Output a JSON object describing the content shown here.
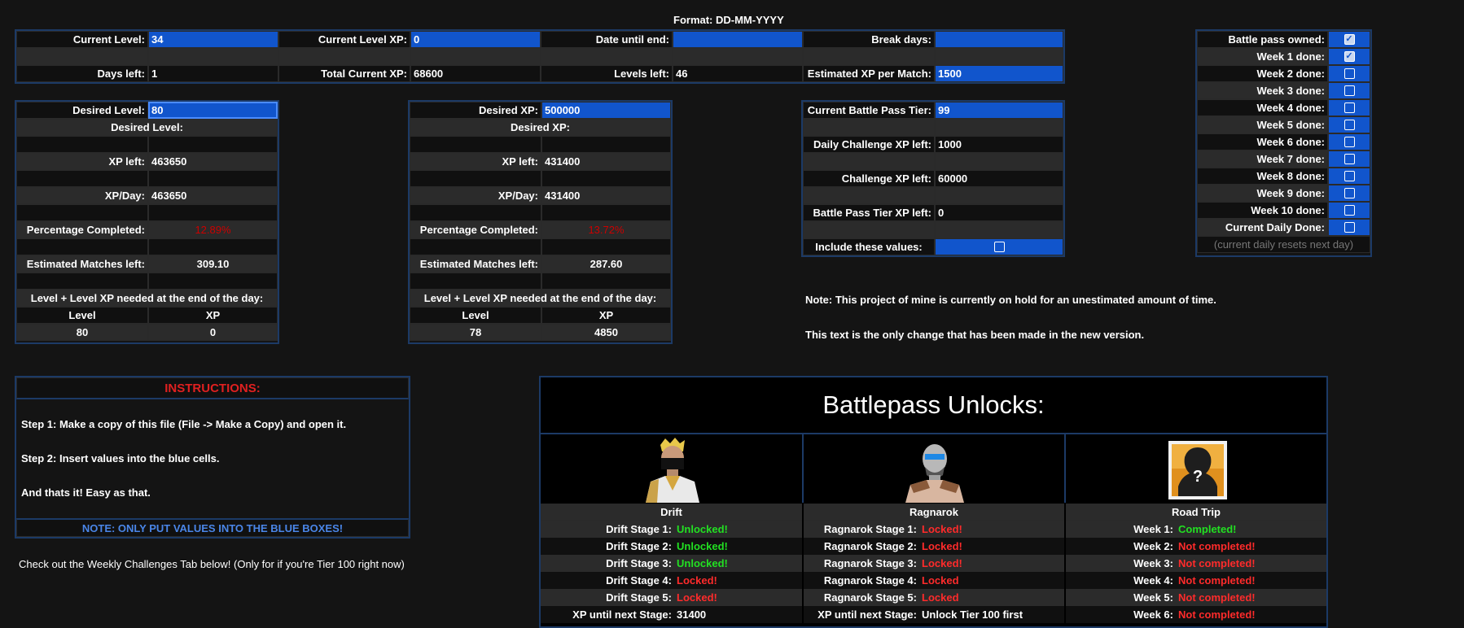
{
  "format_note": "Format: DD-MM-YYYY",
  "top": {
    "current_level_label": "Current Level:",
    "current_level": "34",
    "current_level_xp_label": "Current Level XP:",
    "current_level_xp": "0",
    "date_until_end_label": "Date until end:",
    "date_until_end": "",
    "break_days_label": "Break days:",
    "break_days": "",
    "days_left_label": "Days left:",
    "days_left": "1",
    "total_current_xp_label": "Total Current XP:",
    "total_current_xp": "68600",
    "levels_left_label": "Levels left:",
    "levels_left": "46",
    "est_xp_label": "Estimated XP per Match:",
    "est_xp": "1500"
  },
  "level_box": {
    "desired_label": "Desired Level:",
    "desired_value": "80",
    "subtitle": "Desired Level:",
    "xp_left_label": "XP left:",
    "xp_left": "463650",
    "xp_day_label": "XP/Day:",
    "xp_day": "463650",
    "pct_label": "Percentage Completed:",
    "pct": "12.89%",
    "matches_label": "Estimated Matches left:",
    "matches": "309.10",
    "eod_label": "Level + Level XP needed at the end of the day:",
    "col_level": "Level",
    "col_xp": "XP",
    "eod_level": "80",
    "eod_xp": "0"
  },
  "xp_box": {
    "desired_label": "Desired XP:",
    "desired_value": "500000",
    "subtitle": "Desired XP:",
    "xp_left_label": "XP left:",
    "xp_left": "431400",
    "xp_day_label": "XP/Day:",
    "xp_day": "431400",
    "pct_label": "Percentage Completed:",
    "pct": "13.72%",
    "matches_label": "Estimated Matches left:",
    "matches": "287.60",
    "eod_label": "Level + Level XP needed at the end of the day:",
    "col_level": "Level",
    "col_xp": "XP",
    "eod_level": "78",
    "eod_xp": "4850"
  },
  "bp_box": {
    "tier_label": "Current Battle Pass Tier:",
    "tier": "99",
    "daily_label": "Daily Challenge XP left:",
    "daily": "1000",
    "challenge_label": "Challenge XP left:",
    "challenge": "60000",
    "tier_xp_label": "Battle Pass Tier XP left:",
    "tier_xp": "0",
    "include_label": "Include these values:"
  },
  "weeks": {
    "items": [
      {
        "label": "Battle pass owned:",
        "checked": true
      },
      {
        "label": "Week 1 done:",
        "checked": true
      },
      {
        "label": "Week 2 done:",
        "checked": false
      },
      {
        "label": "Week 3 done:",
        "checked": false
      },
      {
        "label": "Week 4 done:",
        "checked": false
      },
      {
        "label": "Week 5 done:",
        "checked": false
      },
      {
        "label": "Week 6 done:",
        "checked": false
      },
      {
        "label": "Week 7 done:",
        "checked": false
      },
      {
        "label": "Week 8 done:",
        "checked": false
      },
      {
        "label": "Week 9 done:",
        "checked": false
      },
      {
        "label": "Week 10 done:",
        "checked": false
      },
      {
        "label": "Current Daily Done:",
        "checked": false
      }
    ],
    "footer": "(current daily resets next day)"
  },
  "notes": {
    "line1": "Note: This project of mine is currently on hold for an unestimated amount of time.",
    "line2": "This text is the only change that has been made in the new version."
  },
  "instructions": {
    "title": "INSTRUCTIONS:",
    "step1": "Step 1: Make a copy of this file (File -> Make a Copy) and open it.",
    "step2": "Step 2: Insert values into the blue cells.",
    "step3": "And thats it! Easy as that.",
    "note": "NOTE: ONLY PUT VALUES INTO THE BLUE BOXES!",
    "weekly": "Check out the Weekly Challenges Tab below! (Only for if you're Tier 100 right now)"
  },
  "unlocks": {
    "title": "Battlepass Unlocks:",
    "drift": {
      "name": "Drift",
      "rows": [
        {
          "label": "Drift Stage 1:",
          "status": "Unlocked!",
          "ok": true
        },
        {
          "label": "Drift Stage 2:",
          "status": "Unlocked!",
          "ok": true
        },
        {
          "label": "Drift Stage 3:",
          "status": "Unlocked!",
          "ok": true
        },
        {
          "label": "Drift Stage 4:",
          "status": "Locked!",
          "ok": false
        },
        {
          "label": "Drift Stage 5:",
          "status": "Locked!",
          "ok": false
        }
      ],
      "next_label": "XP until next Stage:",
      "next_value": "31400"
    },
    "ragnarok": {
      "name": "Ragnarok",
      "rows": [
        {
          "label": "Ragnarok Stage 1:",
          "status": "Locked!",
          "ok": false
        },
        {
          "label": "Ragnarok Stage 2:",
          "status": "Locked!",
          "ok": false
        },
        {
          "label": "Ragnarok Stage 3:",
          "status": "Locked!",
          "ok": false
        },
        {
          "label": "Ragnarok Stage 4:",
          "status": "Locked",
          "ok": false
        },
        {
          "label": "Ragnarok Stage 5:",
          "status": "Locked",
          "ok": false
        }
      ],
      "next_label": "XP until next Stage:",
      "next_value": "Unlock Tier 100 first"
    },
    "roadtrip": {
      "name": "Road Trip",
      "rows": [
        {
          "label": "Week 1:",
          "status": "Completed!",
          "ok": true
        },
        {
          "label": "Week 2:",
          "status": "Not completed!",
          "ok": false
        },
        {
          "label": "Week 3:",
          "status": "Not completed!",
          "ok": false
        },
        {
          "label": "Week 4:",
          "status": "Not completed!",
          "ok": false
        },
        {
          "label": "Week 5:",
          "status": "Not completed!",
          "ok": false
        },
        {
          "label": "Week 6:",
          "status": "Not completed!",
          "ok": false
        }
      ]
    }
  }
}
